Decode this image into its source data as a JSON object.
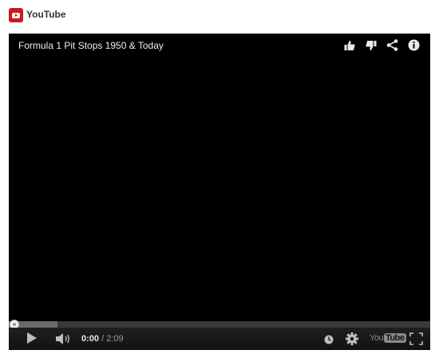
{
  "header": {
    "site_name": "YouTube",
    "logo_icon": "youtube-play-icon",
    "logo_color": "#cc181e"
  },
  "video": {
    "title": "Formula 1 Pit Stops 1950 & Today",
    "actions": [
      "like-icon",
      "dislike-icon",
      "share-icon",
      "info-icon"
    ]
  },
  "player": {
    "progress_played_fraction": 0.0,
    "progress_buffered_fraction": 0.115,
    "current_time": "0:00",
    "separator": "/",
    "duration": "2:09",
    "buttons": [
      "play-icon",
      "volume-icon",
      "watch-later-icon",
      "settings-icon",
      "youtube-logo",
      "fullscreen-icon"
    ],
    "brand": {
      "you": "You",
      "tube": "Tube"
    }
  }
}
